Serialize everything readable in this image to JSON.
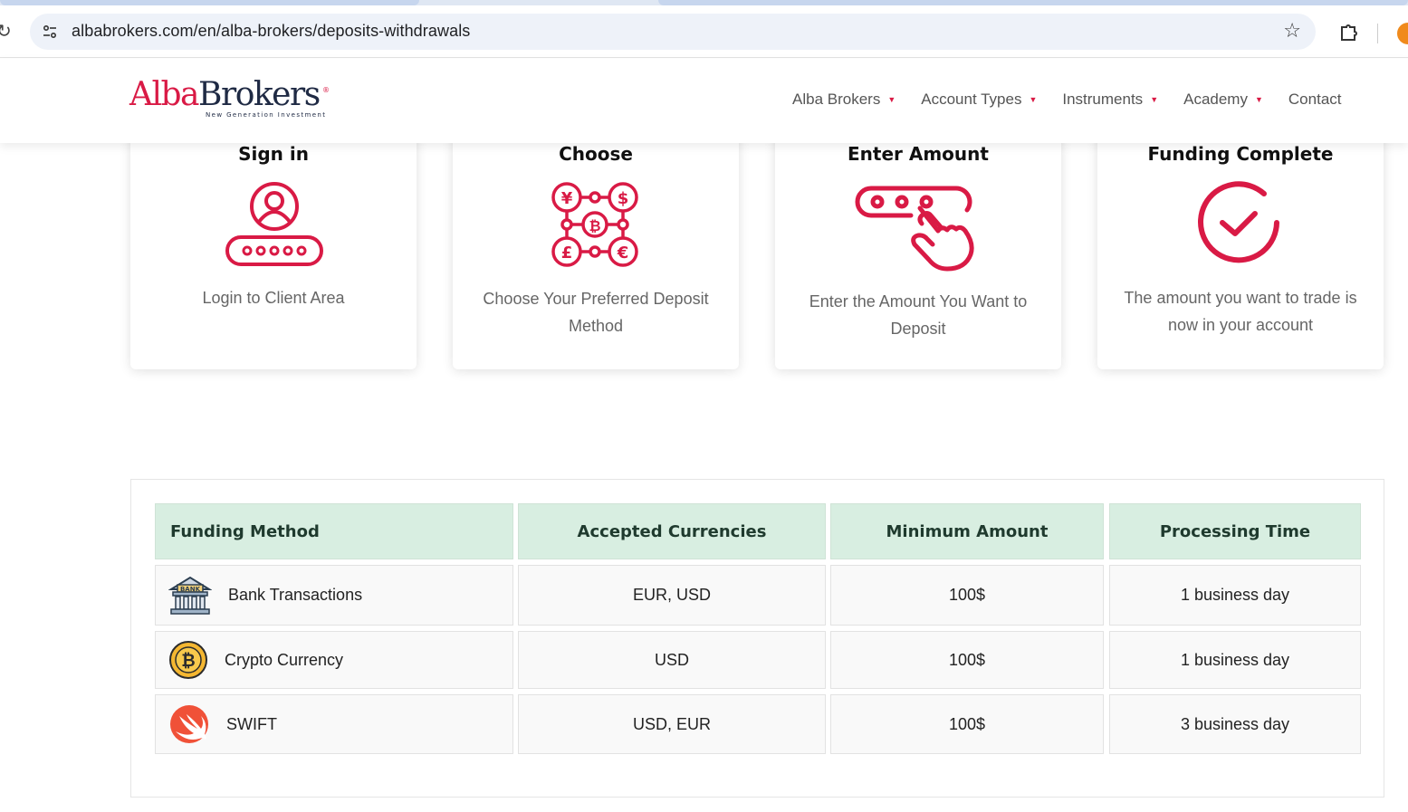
{
  "browser": {
    "url": "albabrokers.com/en/alba-brokers/deposits-withdrawals"
  },
  "header": {
    "logo_alba": "Alba",
    "logo_brokers": "Brokers",
    "logo_reg": "®",
    "logo_tagline": "New Generation Investment",
    "nav": [
      {
        "label": "Alba Brokers",
        "dropdown": true
      },
      {
        "label": "Account Types",
        "dropdown": true
      },
      {
        "label": "Instruments",
        "dropdown": true
      },
      {
        "label": "Academy",
        "dropdown": true
      },
      {
        "label": "Contact",
        "dropdown": false
      }
    ],
    "caret": "▼"
  },
  "steps": [
    {
      "title": "Sign in",
      "desc": "Login to Client Area",
      "icon": "user-password-icon"
    },
    {
      "title": "Choose",
      "desc": "Choose Your Preferred Deposit Method",
      "icon": "currency-network-icon"
    },
    {
      "title": "Enter Amount",
      "desc": "Enter the Amount You Want to Deposit",
      "icon": "hand-pin-icon"
    },
    {
      "title": "Funding Complete",
      "desc": "The amount you want to trade is now in your account",
      "icon": "check-circle-icon"
    }
  ],
  "funding_table": {
    "headers": [
      "Funding Method",
      "Accepted Currencies",
      "Minimum Amount",
      "Processing Time"
    ],
    "rows": [
      {
        "method": "Bank Transactions",
        "icon": "bank-icon",
        "icon_text": "BANK",
        "currencies": "EUR, USD",
        "minimum": "100$",
        "time": "1 business day"
      },
      {
        "method": "Crypto Currency",
        "icon": "bitcoin-icon",
        "currencies": "USD",
        "minimum": "100$",
        "time": "1 business day"
      },
      {
        "method": "SWIFT",
        "icon": "swift-icon",
        "currencies": "USD, EUR",
        "minimum": "100$",
        "time": "3 business day"
      }
    ]
  },
  "colors": {
    "brand_red": "#d91a45",
    "brand_navy": "#1f2a44",
    "table_header_bg": "#d8eee1"
  }
}
